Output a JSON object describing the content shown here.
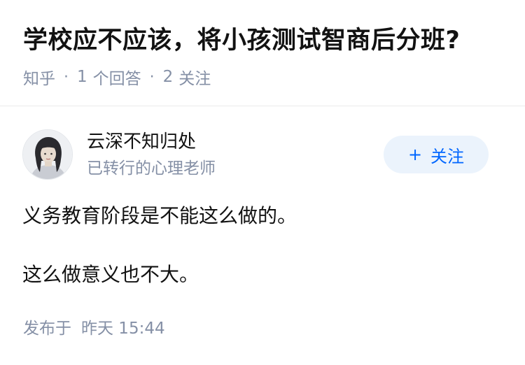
{
  "question": {
    "title": "学校应不应该，将小孩测试智商后分班?",
    "source": "知乎",
    "answers_count": "1",
    "answers_label": "个回答",
    "followers_count": "2",
    "followers_label": "关注",
    "separator": "·"
  },
  "author": {
    "name": "云深不知归处",
    "headline": "已转行的心理老师",
    "avatar_icon": "avatar-girl-portrait"
  },
  "follow_button": {
    "plus": "+",
    "label": "关注",
    "bg_color": "#ebf3fc",
    "text_color": "#0066ff"
  },
  "answer": {
    "paragraphs": [
      "义务教育阶段是不能这么做的。",
      "这么做意义也不大。"
    ],
    "publish_label": "发布于",
    "publish_time": "昨天 15:44"
  },
  "colors": {
    "text_primary": "#121212",
    "text_secondary": "#8590a6",
    "divider": "#ebebeb"
  }
}
